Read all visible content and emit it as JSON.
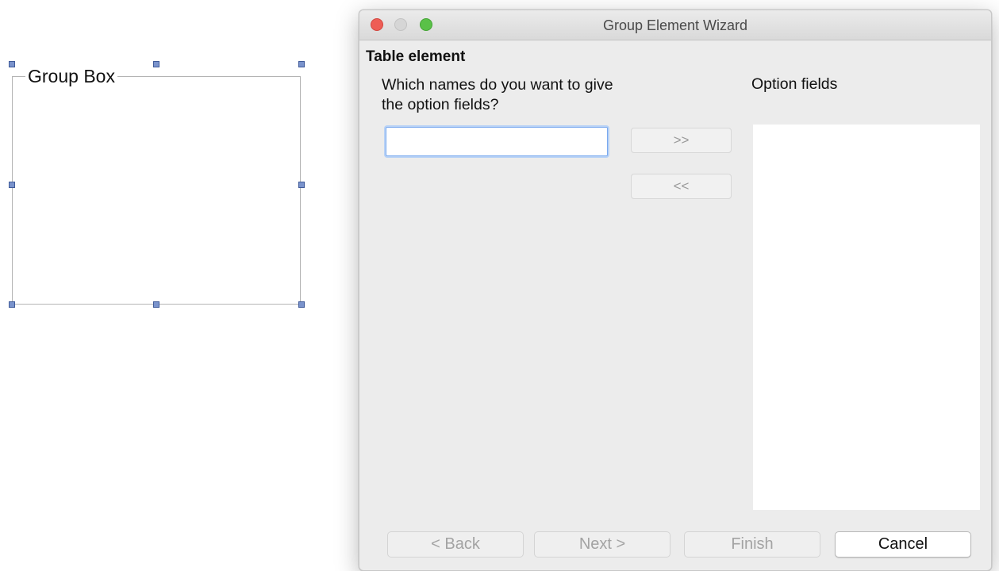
{
  "canvas": {
    "groupbox_label": "Group Box"
  },
  "window": {
    "title": "Group Element Wizard"
  },
  "wizard": {
    "section_title": "Table element",
    "question": "Which names do you want to give the option fields?",
    "name_input": {
      "value": "",
      "placeholder": ""
    },
    "add_label": ">>",
    "remove_label": "<<",
    "option_fields_label": "Option fields",
    "option_fields": []
  },
  "footer": {
    "back_label": "< Back",
    "next_label": "Next >",
    "finish_label": "Finish",
    "cancel_label": "Cancel"
  }
}
